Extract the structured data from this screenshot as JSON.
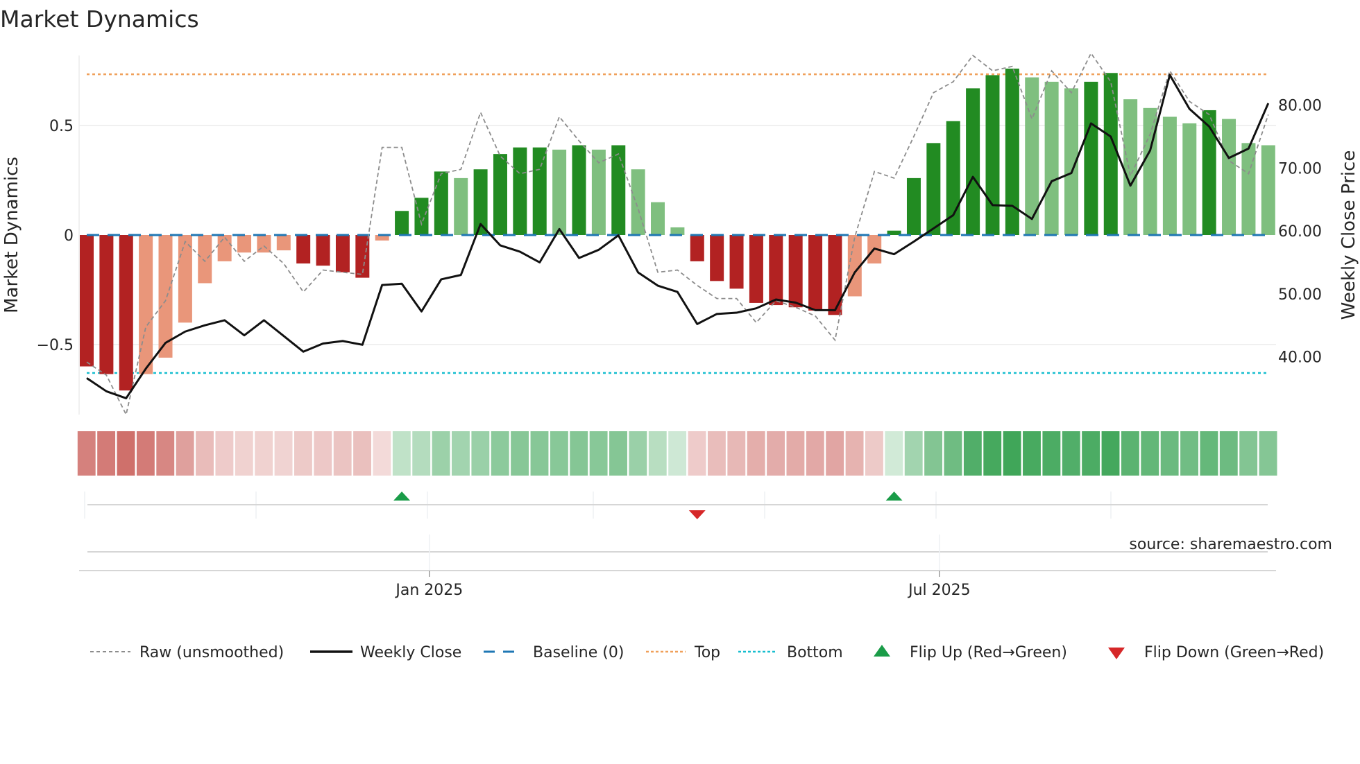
{
  "chart_data": {
    "type": "bar",
    "title": "Market Dynamics",
    "ylabel": "Market Dynamics",
    "y2label": "Weekly Close Price",
    "ylim": [
      -0.82,
      0.82
    ],
    "y2lim": [
      30.8,
      87.9
    ],
    "yticks": [
      {
        "v": 0.5,
        "label": "0.5"
      },
      {
        "v": 0,
        "label": "0"
      },
      {
        "v": -0.5,
        "label": "−0.5"
      }
    ],
    "y2ticks": [
      {
        "v": 40,
        "label": "40.00"
      },
      {
        "v": 50,
        "label": "50.00"
      },
      {
        "v": 60,
        "label": "60.00"
      },
      {
        "v": 70,
        "label": "70.00"
      },
      {
        "v": 80,
        "label": "80.00"
      }
    ],
    "xticks": [
      {
        "index": 17.4,
        "label": "Jan 2025"
      },
      {
        "index": 43.3,
        "label": "Jul 2025"
      }
    ],
    "top_level": 0.734,
    "bottom_level": -0.63,
    "momentum": [
      -0.6,
      -0.635,
      -0.71,
      -0.635,
      -0.56,
      -0.4,
      -0.22,
      -0.12,
      -0.08,
      -0.08,
      -0.07,
      -0.13,
      -0.14,
      -0.17,
      -0.195,
      -0.025,
      0.11,
      0.17,
      0.29,
      0.26,
      0.3,
      0.37,
      0.4,
      0.4,
      0.39,
      0.41,
      0.39,
      0.41,
      0.3,
      0.15,
      0.035,
      -0.12,
      -0.21,
      -0.245,
      -0.31,
      -0.32,
      -0.33,
      -0.345,
      -0.365,
      -0.28,
      -0.13,
      0.02,
      0.26,
      0.42,
      0.52,
      0.67,
      0.73,
      0.76,
      0.72,
      0.7,
      0.67,
      0.7,
      0.74,
      0.62,
      0.58,
      0.54,
      0.51,
      0.57,
      0.53,
      0.42,
      0.41
    ],
    "strength": [
      "strong",
      "strong",
      "strong",
      "weak",
      "weak",
      "weak",
      "weak",
      "weak",
      "weak",
      "weak",
      "weak",
      "strong",
      "strong",
      "strong",
      "strong",
      "weak",
      "strong",
      "strong",
      "strong",
      "weak",
      "strong",
      "strong",
      "strong",
      "strong",
      "weak",
      "strong",
      "weak",
      "strong",
      "weak",
      "weak",
      "weak",
      "strong",
      "strong",
      "strong",
      "strong",
      "strong",
      "strong",
      "strong",
      "strong",
      "weak",
      "weak",
      "strong",
      "strong",
      "strong",
      "strong",
      "strong",
      "strong",
      "strong",
      "weak",
      "weak",
      "weak",
      "strong",
      "strong",
      "weak",
      "weak",
      "weak",
      "weak",
      "strong",
      "weak",
      "weak",
      "weak"
    ],
    "raw": [
      -0.58,
      -0.64,
      -0.82,
      -0.42,
      -0.3,
      -0.03,
      -0.12,
      -0.01,
      -0.12,
      -0.05,
      -0.13,
      -0.26,
      -0.16,
      -0.17,
      -0.18,
      0.4,
      0.4,
      0.05,
      0.28,
      0.3,
      0.56,
      0.36,
      0.28,
      0.3,
      0.54,
      0.43,
      0.33,
      0.37,
      0.12,
      -0.17,
      -0.16,
      -0.23,
      -0.29,
      -0.29,
      -0.4,
      -0.3,
      -0.33,
      -0.37,
      -0.48,
      -0.01,
      0.29,
      0.26,
      0.45,
      0.65,
      0.7,
      0.82,
      0.75,
      0.77,
      0.53,
      0.75,
      0.65,
      0.83,
      0.7,
      0.27,
      0.46,
      0.75,
      0.61,
      0.55,
      0.34,
      0.28,
      0.55
    ],
    "weekly_close": [
      36.6,
      34.5,
      33.4,
      38.1,
      42.2,
      44.0,
      45.0,
      45.8,
      43.4,
      45.8,
      43.3,
      40.8,
      42.1,
      42.5,
      41.9,
      51.4,
      51.6,
      47.2,
      52.3,
      53.0,
      61.1,
      57.7,
      56.7,
      55.0,
      60.3,
      55.7,
      57.0,
      59.3,
      53.4,
      51.3,
      50.3,
      45.2,
      46.8,
      47.0,
      47.7,
      49.1,
      48.6,
      47.4,
      47.4,
      53.4,
      57.2,
      56.3,
      58.3,
      60.4,
      62.5,
      68.6,
      64.1,
      64.0,
      61.9,
      67.9,
      69.2,
      77.1,
      75.0,
      67.2,
      72.8,
      84.8,
      79.4,
      76.6,
      71.6,
      73.1,
      80.3
    ],
    "flips": [
      {
        "index": 16,
        "type": "up"
      },
      {
        "index": 31,
        "type": "down"
      },
      {
        "index": 41,
        "type": "up"
      }
    ],
    "colors": {
      "strong_red": "#b22222",
      "weak_red": "#e9967a",
      "strong_green": "#228b22",
      "weak_green": "#7fbf7f",
      "raw": "#8c8c8c",
      "close": "#111111",
      "baseline": "#1f77b4",
      "top": "#f0a05a",
      "bottom": "#17becf",
      "flip_up": "#1a9c48",
      "flip_down": "#d62728"
    },
    "legend": {
      "raw": "Raw (unsmoothed)",
      "close": "Weekly Close",
      "baseline": "Baseline (0)",
      "top": "Top",
      "bottom": "Bottom",
      "flip_up": "Flip Up (Red→Green)",
      "flip_down": "Flip Down (Green→Red)"
    },
    "source": "source: sharemaestro.com"
  }
}
